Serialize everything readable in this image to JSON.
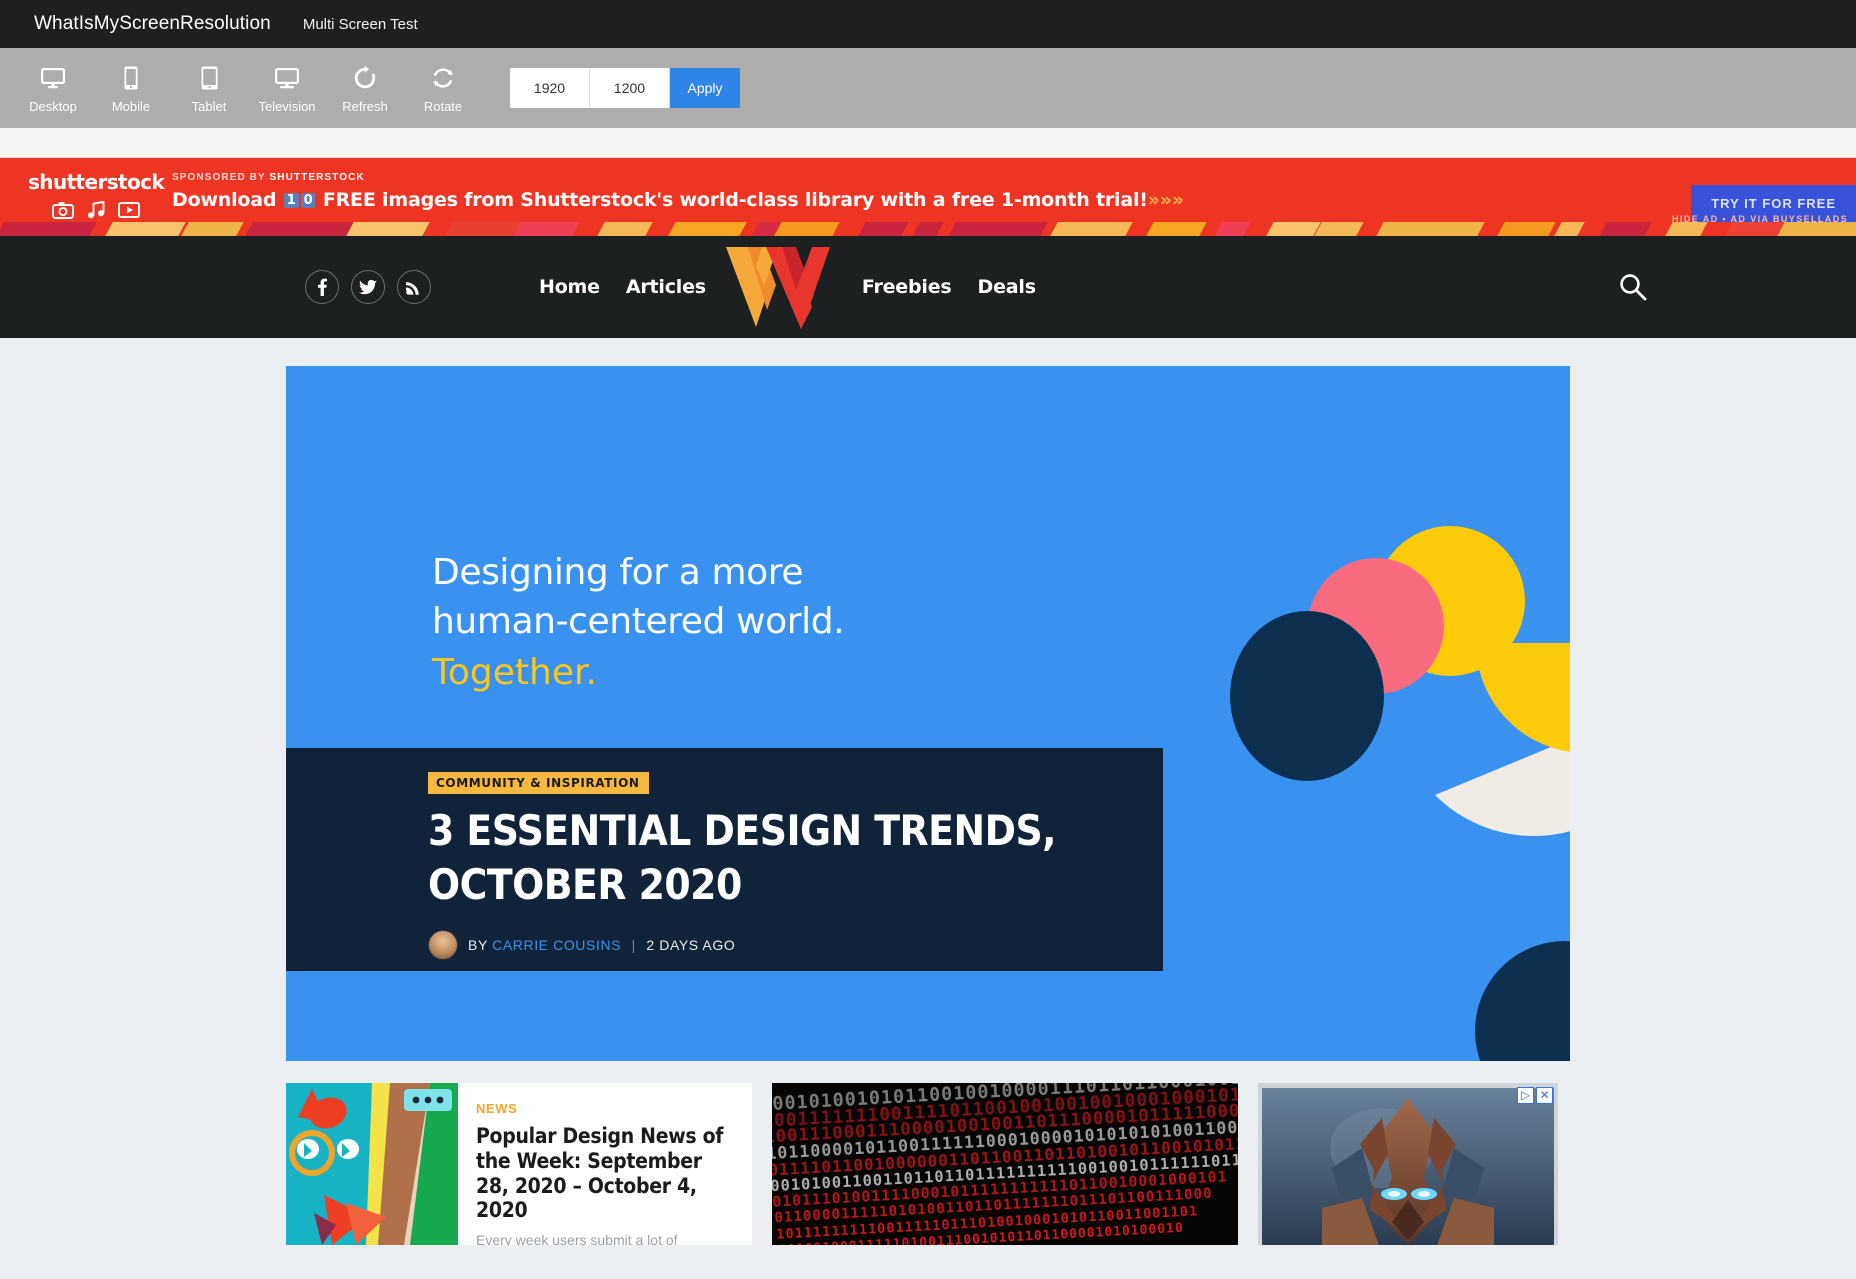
{
  "topbar": {
    "brand": "WhatIsMyScreenResolution",
    "link": "Multi Screen Test"
  },
  "devicebar": {
    "buttons": [
      {
        "label": "Desktop",
        "icon": "desktop-icon"
      },
      {
        "label": "Mobile",
        "icon": "mobile-icon"
      },
      {
        "label": "Tablet",
        "icon": "tablet-icon"
      },
      {
        "label": "Television",
        "icon": "television-icon"
      },
      {
        "label": "Refresh",
        "icon": "refresh-icon"
      },
      {
        "label": "Rotate",
        "icon": "rotate-icon"
      }
    ],
    "width_value": "1920",
    "height_value": "1200",
    "apply_label": "Apply",
    "accent": "#2f86e8"
  },
  "ad": {
    "brand": "shutterstock",
    "sponsored_prefix": "SPONSORED BY ",
    "sponsored_brand": "SHUTTERSTOCK",
    "headline_pre": "Download ",
    "badge_1": "1",
    "badge_2": "0",
    "headline_post": " FREE images from Shutterstock's world-class library with a free 1-month trial!",
    "emoji": "»»»",
    "cta": "TRY IT FOR FREE",
    "footer": "HIDE AD • AD VIA BUYSELLADS",
    "bg": "#ee3524",
    "cta_bg": "#3853d9"
  },
  "sitenav": {
    "social": [
      {
        "name": "facebook-icon",
        "glyph": "f"
      },
      {
        "name": "twitter-icon",
        "glyph": "t"
      },
      {
        "name": "rss-icon",
        "glyph": "rss"
      }
    ],
    "links_left": [
      "Home",
      "Articles"
    ],
    "links_right": [
      "Freebies",
      "Deals"
    ],
    "logo_alt": "W",
    "logo_left_color": "#f6a93b",
    "logo_right_color": "#e8352e",
    "search_icon": "search-icon",
    "bg": "#1d2021"
  },
  "hero": {
    "bg": "#3a92f0",
    "line1": "Designing for a more",
    "line2": "human-centered world.",
    "line3": "Together.",
    "category": "COMMUNITY & INSPIRATION",
    "title": "3 ESSENTIAL DESIGN TRENDS, OCTOBER 2020",
    "by_prefix": "BY",
    "author": "CARRIE COUSINS",
    "separator": "|",
    "time": "2 DAYS AGO",
    "shape_colors": {
      "yellow": "#fdcb09",
      "pink": "#f96b7f",
      "navy": "#0d2f4f",
      "cream": "#f0ebe4"
    }
  },
  "cards": [
    {
      "kicker": "NEWS",
      "title": "Popular Design News of the Week: September 28, 2020 – October 4, 2020",
      "excerpt": "Every week users submit a lot of",
      "thumb": "illustration-cat-thumbnail"
    },
    {
      "kicker": "",
      "title": "",
      "excerpt": "",
      "thumb": "binary-code-thumbnail"
    },
    {
      "kicker": "",
      "title": "",
      "excerpt": "",
      "thumb": "game-ad-thumbnail",
      "ad_choices": "▷",
      "ad_close": "✕"
    }
  ]
}
